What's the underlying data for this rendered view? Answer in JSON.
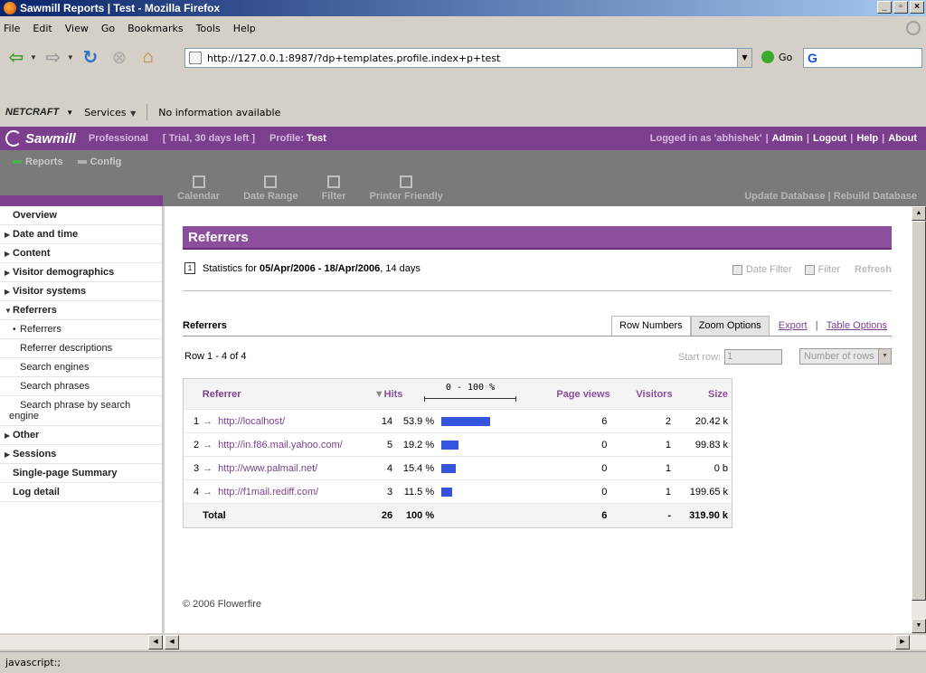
{
  "window": {
    "title": "Sawmill Reports | Test - Mozilla Firefox"
  },
  "menu": [
    "File",
    "Edit",
    "View",
    "Go",
    "Bookmarks",
    "Tools",
    "Help"
  ],
  "nav": {
    "url": "http://127.0.0.1:8987/?dp+templates.profile.index+p+test",
    "go_label": "Go",
    "search_letter": "G"
  },
  "netcraft": {
    "logo": "NETCRAFT",
    "services_label": "Services",
    "info": "No information available"
  },
  "sawmill": {
    "brand": "Sawmill",
    "edition": "Professional",
    "trial": "[ Trial, 30 days left ]",
    "profile_label": "Profile:",
    "profile_name": "Test",
    "logged_in": "Logged in as 'abhishek'",
    "admin": "Admin",
    "logout": "Logout",
    "help": "Help",
    "about": "About",
    "tab_reports": "Reports",
    "tab_config": "Config",
    "tool_calendar": "Calendar",
    "tool_daterange": "Date Range",
    "tool_filter": "Filter",
    "tool_printer": "Printer Friendly",
    "update_db": "Update Database",
    "rebuild_db": "Rebuild Database"
  },
  "sidebar": {
    "overview": "Overview",
    "date_time": "Date and time",
    "content": "Content",
    "visitor_demographics": "Visitor demographics",
    "visitor_systems": "Visitor systems",
    "referrers": "Referrers",
    "sub_referrers": "Referrers",
    "sub_referrer_desc": "Referrer descriptions",
    "sub_search_engines": "Search engines",
    "sub_search_phrases": "Search phrases",
    "sub_search_phrase_engine": "Search phrase by search engine",
    "other": "Other",
    "sessions": "Sessions",
    "single_page": "Single-page Summary",
    "log_detail": "Log detail"
  },
  "report": {
    "title": "Referrers",
    "stats_prefix": "Statistics for",
    "date_range": "05/Apr/2006 - 18/Apr/2006",
    "days": ", 14 days",
    "date_filter": "Date Filter",
    "filter": "Filter",
    "refresh": "Refresh",
    "table_title": "Referrers",
    "tab_row_numbers": "Row Numbers",
    "tab_zoom": "Zoom Options",
    "export": "Export",
    "table_options": "Table Options",
    "row_info": "Row 1 - 4 of 4",
    "start_row_label": "Start row:",
    "start_row_value": "1",
    "number_of_rows": "Number of rows",
    "columns": {
      "referrer": "Referrer",
      "hits": "Hits",
      "scale": "0 - 100 %",
      "page_views": "Page views",
      "visitors": "Visitors",
      "size": "Size"
    },
    "rows": [
      {
        "n": "1",
        "ref": "http://localhost/",
        "hits": "14",
        "pct": "53.9 %",
        "share": 53.9,
        "pv": "6",
        "vis": "2",
        "size": "20.42 k"
      },
      {
        "n": "2",
        "ref": "http://in.f86.mail.yahoo.com/",
        "hits": "5",
        "pct": "19.2 %",
        "share": 19.2,
        "pv": "0",
        "vis": "1",
        "size": "99.83 k"
      },
      {
        "n": "3",
        "ref": "http://www.palmail.net/",
        "hits": "4",
        "pct": "15.4 %",
        "share": 15.4,
        "pv": "0",
        "vis": "1",
        "size": "0 b"
      },
      {
        "n": "4",
        "ref": "http://f1mail.rediff.com/",
        "hits": "3",
        "pct": "11.5 %",
        "share": 11.5,
        "pv": "0",
        "vis": "1",
        "size": "199.65 k"
      }
    ],
    "total": {
      "label": "Total",
      "hits": "26",
      "pct": "100 %",
      "pv": "6",
      "vis": "-",
      "size": "319.90 k"
    },
    "footer": "© 2006 Flowerfire"
  },
  "status": "javascript:;"
}
